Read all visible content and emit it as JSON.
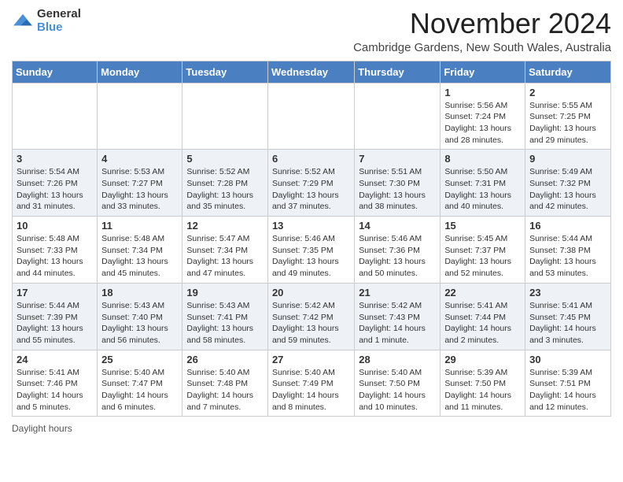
{
  "header": {
    "logo_general": "General",
    "logo_blue": "Blue",
    "month_title": "November 2024",
    "location": "Cambridge Gardens, New South Wales, Australia"
  },
  "days_of_week": [
    "Sunday",
    "Monday",
    "Tuesday",
    "Wednesday",
    "Thursday",
    "Friday",
    "Saturday"
  ],
  "weeks": [
    [
      {
        "day": "",
        "info": ""
      },
      {
        "day": "",
        "info": ""
      },
      {
        "day": "",
        "info": ""
      },
      {
        "day": "",
        "info": ""
      },
      {
        "day": "",
        "info": ""
      },
      {
        "day": "1",
        "info": "Sunrise: 5:56 AM\nSunset: 7:24 PM\nDaylight: 13 hours and 28 minutes."
      },
      {
        "day": "2",
        "info": "Sunrise: 5:55 AM\nSunset: 7:25 PM\nDaylight: 13 hours and 29 minutes."
      }
    ],
    [
      {
        "day": "3",
        "info": "Sunrise: 5:54 AM\nSunset: 7:26 PM\nDaylight: 13 hours and 31 minutes."
      },
      {
        "day": "4",
        "info": "Sunrise: 5:53 AM\nSunset: 7:27 PM\nDaylight: 13 hours and 33 minutes."
      },
      {
        "day": "5",
        "info": "Sunrise: 5:52 AM\nSunset: 7:28 PM\nDaylight: 13 hours and 35 minutes."
      },
      {
        "day": "6",
        "info": "Sunrise: 5:52 AM\nSunset: 7:29 PM\nDaylight: 13 hours and 37 minutes."
      },
      {
        "day": "7",
        "info": "Sunrise: 5:51 AM\nSunset: 7:30 PM\nDaylight: 13 hours and 38 minutes."
      },
      {
        "day": "8",
        "info": "Sunrise: 5:50 AM\nSunset: 7:31 PM\nDaylight: 13 hours and 40 minutes."
      },
      {
        "day": "9",
        "info": "Sunrise: 5:49 AM\nSunset: 7:32 PM\nDaylight: 13 hours and 42 minutes."
      }
    ],
    [
      {
        "day": "10",
        "info": "Sunrise: 5:48 AM\nSunset: 7:33 PM\nDaylight: 13 hours and 44 minutes."
      },
      {
        "day": "11",
        "info": "Sunrise: 5:48 AM\nSunset: 7:34 PM\nDaylight: 13 hours and 45 minutes."
      },
      {
        "day": "12",
        "info": "Sunrise: 5:47 AM\nSunset: 7:34 PM\nDaylight: 13 hours and 47 minutes."
      },
      {
        "day": "13",
        "info": "Sunrise: 5:46 AM\nSunset: 7:35 PM\nDaylight: 13 hours and 49 minutes."
      },
      {
        "day": "14",
        "info": "Sunrise: 5:46 AM\nSunset: 7:36 PM\nDaylight: 13 hours and 50 minutes."
      },
      {
        "day": "15",
        "info": "Sunrise: 5:45 AM\nSunset: 7:37 PM\nDaylight: 13 hours and 52 minutes."
      },
      {
        "day": "16",
        "info": "Sunrise: 5:44 AM\nSunset: 7:38 PM\nDaylight: 13 hours and 53 minutes."
      }
    ],
    [
      {
        "day": "17",
        "info": "Sunrise: 5:44 AM\nSunset: 7:39 PM\nDaylight: 13 hours and 55 minutes."
      },
      {
        "day": "18",
        "info": "Sunrise: 5:43 AM\nSunset: 7:40 PM\nDaylight: 13 hours and 56 minutes."
      },
      {
        "day": "19",
        "info": "Sunrise: 5:43 AM\nSunset: 7:41 PM\nDaylight: 13 hours and 58 minutes."
      },
      {
        "day": "20",
        "info": "Sunrise: 5:42 AM\nSunset: 7:42 PM\nDaylight: 13 hours and 59 minutes."
      },
      {
        "day": "21",
        "info": "Sunrise: 5:42 AM\nSunset: 7:43 PM\nDaylight: 14 hours and 1 minute."
      },
      {
        "day": "22",
        "info": "Sunrise: 5:41 AM\nSunset: 7:44 PM\nDaylight: 14 hours and 2 minutes."
      },
      {
        "day": "23",
        "info": "Sunrise: 5:41 AM\nSunset: 7:45 PM\nDaylight: 14 hours and 3 minutes."
      }
    ],
    [
      {
        "day": "24",
        "info": "Sunrise: 5:41 AM\nSunset: 7:46 PM\nDaylight: 14 hours and 5 minutes."
      },
      {
        "day": "25",
        "info": "Sunrise: 5:40 AM\nSunset: 7:47 PM\nDaylight: 14 hours and 6 minutes."
      },
      {
        "day": "26",
        "info": "Sunrise: 5:40 AM\nSunset: 7:48 PM\nDaylight: 14 hours and 7 minutes."
      },
      {
        "day": "27",
        "info": "Sunrise: 5:40 AM\nSunset: 7:49 PM\nDaylight: 14 hours and 8 minutes."
      },
      {
        "day": "28",
        "info": "Sunrise: 5:40 AM\nSunset: 7:50 PM\nDaylight: 14 hours and 10 minutes."
      },
      {
        "day": "29",
        "info": "Sunrise: 5:39 AM\nSunset: 7:50 PM\nDaylight: 14 hours and 11 minutes."
      },
      {
        "day": "30",
        "info": "Sunrise: 5:39 AM\nSunset: 7:51 PM\nDaylight: 14 hours and 12 minutes."
      }
    ]
  ],
  "footer": {
    "daylight_label": "Daylight hours"
  }
}
